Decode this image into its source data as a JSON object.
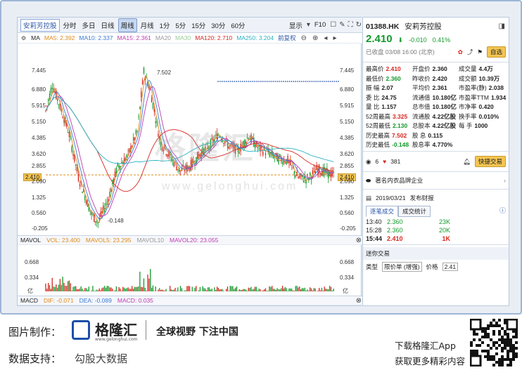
{
  "toolbar": {
    "title": "安莉芳控股",
    "periods": [
      "分时",
      "多日",
      "日线",
      "周线",
      "月线",
      "1分",
      "5分",
      "15分",
      "30分",
      "60分"
    ],
    "active_period": "周线",
    "display": "显示",
    "f10": "F10"
  },
  "ma": {
    "label": "MA",
    "ma5": "MA5: 2.392",
    "ma10": "MA10: 2.337",
    "ma15": "MA15: 2.361",
    "ma20": "MA20",
    "ma30": "MA30",
    "ma120": "MA120: 2.710",
    "ma250": "MA250: 3.204",
    "restore": "前复权"
  },
  "yaxis_left": [
    "7.445",
    "6.880",
    "5.915",
    "5.150",
    "4.385",
    "3.620",
    "2.855",
    "2.410",
    "2.090",
    "1.325",
    "0.560",
    "-0.205"
  ],
  "yaxis_right": [
    "7.445",
    "6.880",
    "5.915",
    "5.150",
    "4.385",
    "3.620",
    "2.855",
    "2.410",
    "2.090",
    "1.325",
    "0.560",
    "-0.205"
  ],
  "annotations": {
    "high": "7.502",
    "low": "-0.148"
  },
  "mavol": {
    "label": "MAVOL",
    "vol": "VOL: 23.400",
    "mavol5": "MAVOL5: 23.295",
    "mavol10": "MAVOL10",
    "mavol20": "MAVOL20: 23.055",
    "ticks": [
      "0.668",
      "0.334",
      "亿"
    ]
  },
  "macd": {
    "label": "MACD",
    "dif": "DIF: -0.071",
    "dea": "DEA: -0.089",
    "macd": "MACD: 0.035"
  },
  "watermark": {
    "main": "格隆汇",
    "sub": "www.gelonghui.com"
  },
  "stock": {
    "code": "01388.HK",
    "name": "安莉芳控股",
    "price": "2.410",
    "change": "-0.010",
    "pct": "0.41%",
    "status": "已收盘 03/08 16:00 (北京)",
    "selfselect": "自选"
  },
  "stats": [
    [
      "最高价",
      "2.410",
      "开盘价",
      "2.360",
      "成交量",
      "4.4万"
    ],
    [
      "最低价",
      "2.360",
      "昨收价",
      "2.420",
      "成交额",
      "10.39万"
    ],
    [
      "振  幅",
      "2.07",
      "平均价",
      "2.361",
      "市盈率(静)",
      "2.038"
    ],
    [
      "委  比",
      "24.75",
      "流通值",
      "10.180亿",
      "市盈率TTM",
      "1.934"
    ],
    [
      "量  比",
      "1.157",
      "总市值",
      "10.180亿",
      "市净率",
      "0.420"
    ],
    [
      "52周最高",
      "3.325",
      "流通股",
      "4.22亿股",
      "换手率",
      "0.010%"
    ],
    [
      "52周最低",
      "2.130",
      "总股本",
      "4.22亿股",
      "每  手",
      "1000"
    ],
    [
      "历史最高",
      "7.502",
      "股  息",
      "0.115",
      "",
      ""
    ],
    [
      "历史最低",
      "-0.148",
      "股息率",
      "4.770%",
      "",
      ""
    ]
  ],
  "social": {
    "count1": "6",
    "count2": "381",
    "fast_trade": "快捷交易"
  },
  "company_tag": "著名内衣品牌企业",
  "news": {
    "date": "2019/03/21",
    "title": "发布财报"
  },
  "tabs": {
    "tab1": "逐笔成交",
    "tab2": "成交统计"
  },
  "trades": [
    [
      "13:40",
      "2.360",
      "23K"
    ],
    [
      "15:28",
      "2.360",
      "20K"
    ],
    [
      "15:44",
      "2.410",
      "1K"
    ]
  ],
  "quick_trade": {
    "title": "迷你交易",
    "type_label": "类型",
    "type_value": "限价单 (增强)",
    "price_label": "价格",
    "price_value": "2.41"
  },
  "footer": {
    "made_by": "图片制作：",
    "brand": "格隆汇",
    "brand_url": "www.gelonghui.com",
    "slogan": "全球视野 下注中国",
    "data_support": "数据支持：",
    "data_source": "勾股大数据",
    "download": "下载格隆汇App",
    "more": "获取更多精彩内容"
  }
}
